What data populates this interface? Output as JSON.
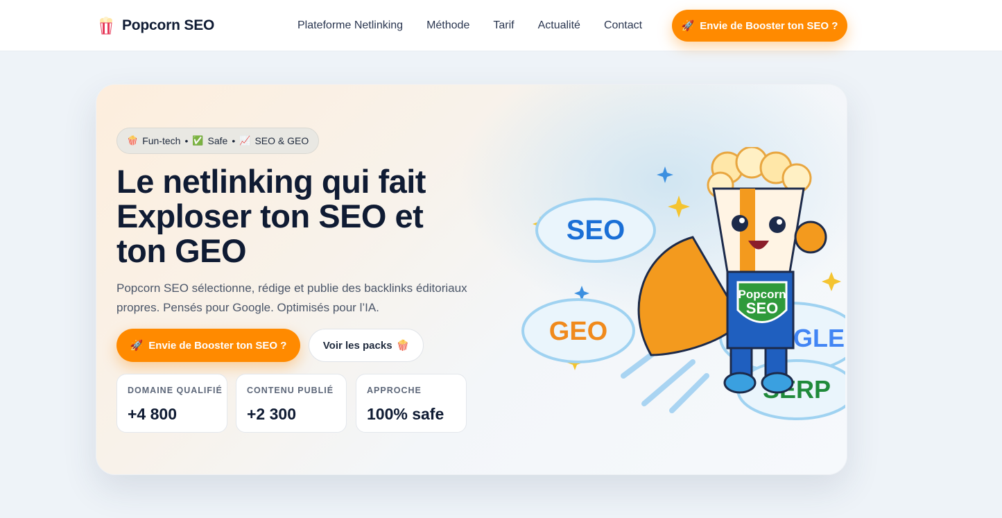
{
  "brand": {
    "name": "Popcorn SEO",
    "icon": "popcorn-icon"
  },
  "nav": {
    "items": [
      "Plateforme Netlinking",
      "Méthode",
      "Tarif",
      "Actualité",
      "Contact"
    ]
  },
  "header_cta": {
    "label": "Envie de Booster ton SEO ?",
    "icon": "rocket-icon"
  },
  "hero": {
    "tagline": {
      "parts": [
        "Fun-tech",
        "Safe",
        "SEO & GEO"
      ],
      "icons": [
        "popcorn-icon",
        "check-icon",
        "chart-icon"
      ],
      "separator": "•"
    },
    "headline": "Le netlinking qui fait Exploser ton SEO et ton GEO",
    "subtitle": "Popcorn SEO sélectionne, rédige et publie des backlinks éditoriaux propres. Pensés pour Google. Optimisés pour l’IA.",
    "primary_cta": "Envie de Booster ton SEO ?",
    "secondary_cta": "Voir les packs",
    "stats": [
      {
        "label": "DOMAINE QUALIFIÉ",
        "value": "+4 800"
      },
      {
        "label": "CONTENU PUBLIÉ",
        "value": "+2 300"
      },
      {
        "label": "APPROCHE",
        "value": "100% safe"
      }
    ],
    "illustration": {
      "mascot_badge_line1": "Popcorn",
      "mascot_badge_line2": "SEO",
      "clouds": [
        "SEO",
        "GEO",
        "GOOGLE",
        "SERP"
      ]
    }
  },
  "colors": {
    "accent": "#ff8a00",
    "text_dark": "#0f1b33",
    "seo_blue": "#1a6fd6",
    "geo_orange": "#f08a1c",
    "serp_green": "#1f8a3a",
    "google_blue": "#4285f4",
    "google_red": "#ea4335",
    "google_yellow": "#fbbc05",
    "google_green": "#34a853"
  }
}
